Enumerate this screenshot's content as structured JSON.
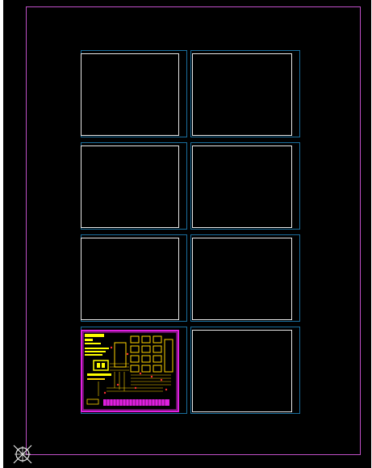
{
  "workspace": {
    "background_color": "#000000",
    "sheet_border_color": "#c050c8",
    "cell_border_color": "#1a6f9e",
    "slot_border_color": "#e8e8e8"
  },
  "panel_grid": {
    "rows": 4,
    "columns": 2,
    "filled_slot": "row-4-col-1",
    "filled_slot_border_color": "#e020e0"
  },
  "pcb_thumbnail": {
    "label_color": "#ffff00",
    "trace_color": "#ffd400",
    "pad_color": "#ff3030",
    "connector_color": "#e020e0"
  },
  "origin_marker": {
    "icon": "origin-crosshair-icon",
    "color": "#e8e8e8"
  }
}
